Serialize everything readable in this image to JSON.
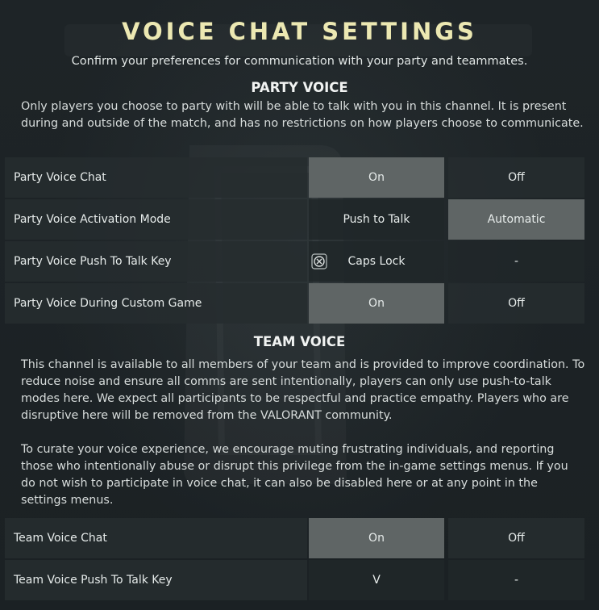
{
  "header": {
    "title": "VOICE CHAT SETTINGS",
    "subtitle": "Confirm your preferences for communication with your party and teammates."
  },
  "party": {
    "heading": "PARTY VOICE",
    "description": "Only players you choose to party with will be able to talk with you in this channel. It is present during and outside of the match, and has no restrictions on how players choose to communicate.",
    "rows": [
      {
        "label": "Party Voice Chat",
        "option_a": "On",
        "option_b": "Off",
        "selected": "a"
      },
      {
        "label": "Party Voice Activation Mode",
        "option_a": "Push to Talk",
        "option_b": "Automatic",
        "selected": "b"
      },
      {
        "label": "Party Voice Push To Talk Key",
        "option_a": "Caps Lock",
        "option_b": "-",
        "selected": "none",
        "clear_icon": "clear-x-icon"
      },
      {
        "label": "Party Voice During Custom Game",
        "option_a": "On",
        "option_b": "Off",
        "selected": "a"
      }
    ]
  },
  "team": {
    "heading": "TEAM VOICE",
    "description_1": "This channel is available to all members of your team and is provided to improve coordination. To reduce noise and ensure all comms are sent intentionally, players can only use push-to-talk modes here. We expect all participants to be respectful and practice empathy.  Players who are disruptive here will be removed from the VALORANT community.",
    "description_2": "To curate your voice experience, we encourage muting frustrating individuals, and reporting those who intentionally abuse or disrupt this privilege from the in-game settings menus. If you do not wish to participate in voice chat, it can also be disabled here or at any point in the settings menus.",
    "rows": [
      {
        "label": "Team Voice Chat",
        "option_a": "On",
        "option_b": "Off",
        "selected": "a"
      },
      {
        "label": "Team Voice Push To Talk Key",
        "option_a": "V",
        "option_b": "-",
        "selected": "none"
      }
    ]
  },
  "colors": {
    "title": "#ece8b2",
    "selected_option": "#5f6565",
    "row_background": "#252c2f"
  }
}
